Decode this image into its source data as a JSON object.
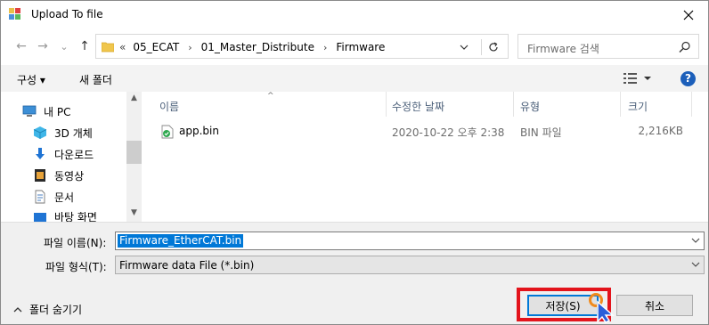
{
  "window": {
    "title": "Upload To file",
    "close_glyph": "✕"
  },
  "nav": {
    "back_glyph": "←",
    "forward_glyph": "→",
    "recent_glyph": "⌄",
    "up_glyph": "↑",
    "breadcrumb_lead": "«",
    "breadcrumbs": [
      "05_ECAT",
      "01_Master_Distribute",
      "Firmware"
    ],
    "separator": "›",
    "search_placeholder": "Firmware 검색"
  },
  "toolbar": {
    "organize_label": "구성 ▾",
    "new_folder_label": "새 폴더",
    "help_glyph": "?"
  },
  "sidebar": {
    "items": [
      {
        "label": "내 PC",
        "icon": "pc-icon"
      },
      {
        "label": "3D 개체",
        "icon": "3d-objects-icon"
      },
      {
        "label": "다운로드",
        "icon": "download-icon"
      },
      {
        "label": "동영상",
        "icon": "video-icon"
      },
      {
        "label": "문서",
        "icon": "document-icon"
      },
      {
        "label": "바탕 화면",
        "icon": "desktop-icon"
      }
    ]
  },
  "file_list": {
    "columns": [
      "이름",
      "수정한 날짜",
      "유형",
      "크기"
    ],
    "rows": [
      {
        "name": "app.bin",
        "modified": "2020-10-22 오후 2:38",
        "type": "BIN 파일",
        "size": "2,216KB"
      }
    ]
  },
  "form": {
    "filename_label": "파일 이름(N):",
    "filename_value": "Firmware_EtherCAT.bin",
    "filetype_label": "파일 형식(T):",
    "filetype_value": "Firmware data File  (*.bin)",
    "hide_folders_label": "폴더 숨기기",
    "save_label": "저장(S)",
    "cancel_label": "취소"
  },
  "colors": {
    "accent": "#0078d7",
    "highlight_box": "#e3141c",
    "help": "#1c5fba"
  }
}
